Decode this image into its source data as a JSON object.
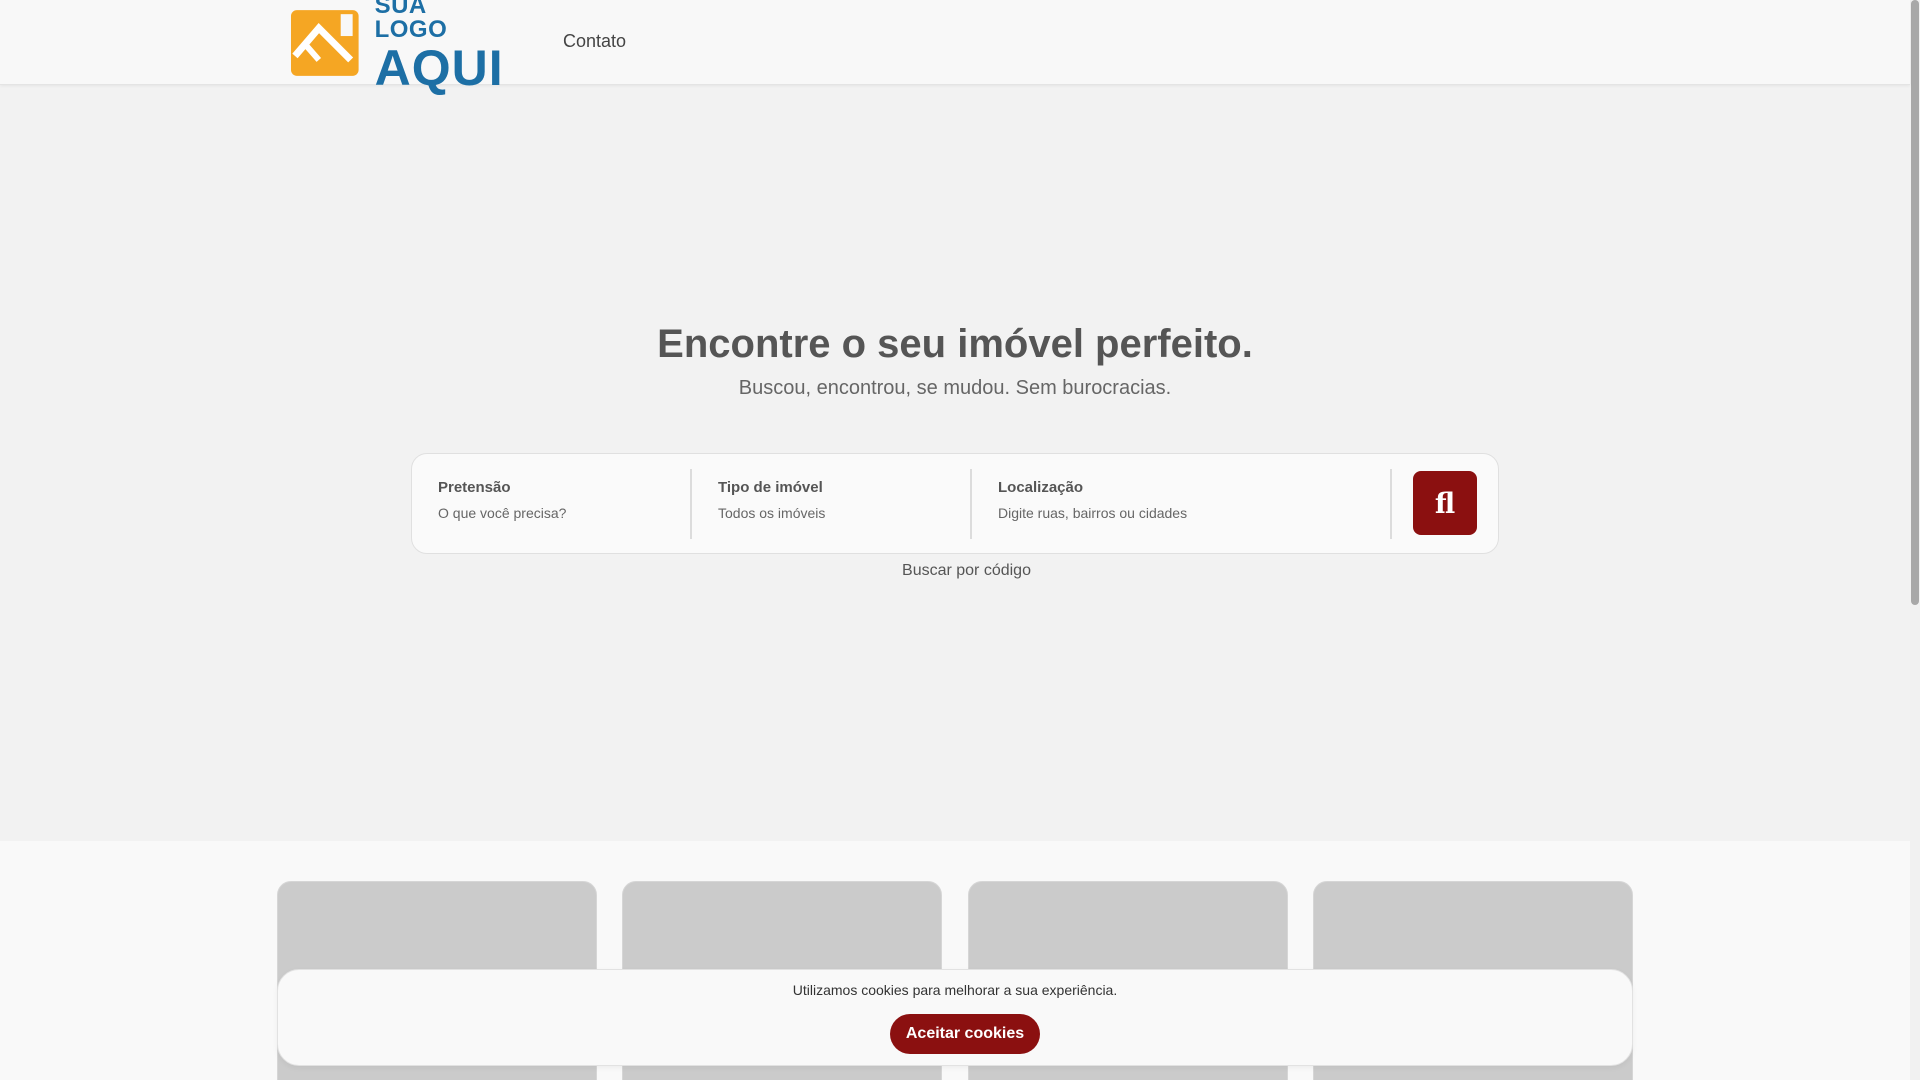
{
  "header": {
    "logo": {
      "line1": "SUA LOGO",
      "line2": "AQUI"
    },
    "nav": {
      "contato": "Contato"
    }
  },
  "hero": {
    "title": "Encontre o seu imóvel perfeito.",
    "subtitle": "Buscou, encontrou, se mudou. Sem burocracias."
  },
  "search": {
    "fields": [
      {
        "label": "Pretensão",
        "value": "O que você precisa?"
      },
      {
        "label": "Tipo de imóvel",
        "value": "Todos os imóveis"
      },
      {
        "label": "Localização",
        "value": "Digite ruas, bairros ou cidades"
      }
    ],
    "button_glyph": "fl",
    "code_link": "Buscar por código"
  },
  "cookie": {
    "message": "Utilizamos cookies para melhorar a sua experiência.",
    "accept": "Aceitar cookies"
  },
  "colors": {
    "accent": "#8b1010",
    "logo_orange": "#f5a623",
    "logo_blue": "#1d6fa5"
  },
  "icons": {
    "logo_mark": "house-roof-icon"
  }
}
